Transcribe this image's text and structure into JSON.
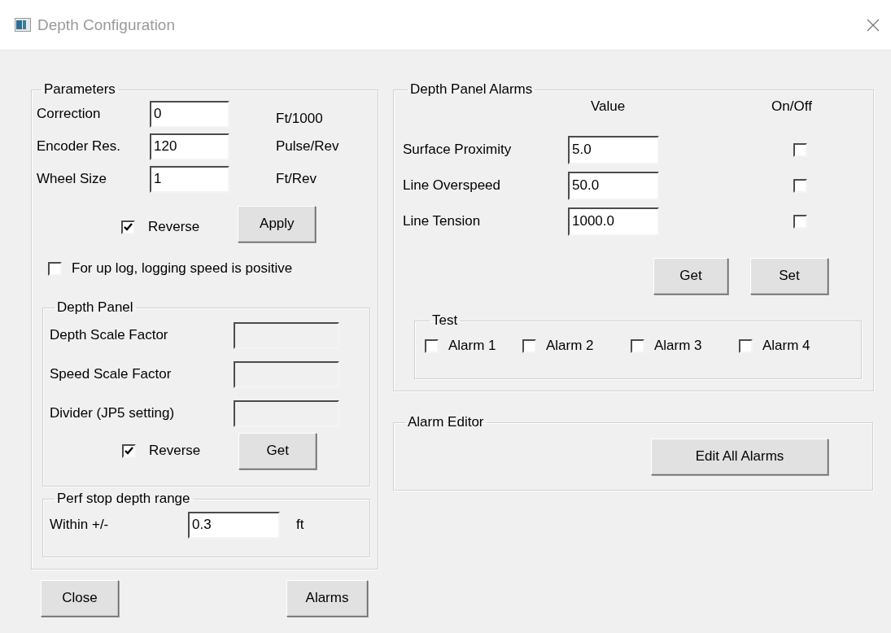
{
  "window": {
    "title": "Depth Configuration"
  },
  "parameters": {
    "title": "Parameters",
    "fields": [
      {
        "label": "Correction",
        "value": "0",
        "unit": "Ft/1000"
      },
      {
        "label": "Encoder Res.",
        "value": "120",
        "unit": "Pulse/Rev"
      },
      {
        "label": "Wheel Size",
        "value": "1",
        "unit": "Ft/Rev"
      }
    ],
    "reverse": {
      "label": "Reverse",
      "checked": true
    },
    "apply_button": "Apply",
    "up_log": {
      "label": "For up log, logging speed is positive",
      "checked": false
    },
    "depth_panel": {
      "title": "Depth Panel",
      "fields": [
        {
          "label": "Depth Scale Factor",
          "disabled": true
        },
        {
          "label": "Speed Scale Factor",
          "disabled": true
        },
        {
          "label": "Divider (JP5 setting)",
          "disabled": true
        }
      ],
      "reverse": {
        "label": "Reverse",
        "checked": true
      },
      "get_button": "Get"
    },
    "perf_stop": {
      "title": "Perf stop depth range",
      "label": "Within +/-",
      "value": "0.3",
      "unit": "ft"
    }
  },
  "alarms_panel": {
    "title": "Depth Panel Alarms",
    "columns": [
      "Value",
      "On/Off"
    ],
    "rows": [
      {
        "label": "Surface Proximity",
        "value": "5.0",
        "on": false
      },
      {
        "label": "Line Overspeed",
        "value": "50.0",
        "on": false
      },
      {
        "label": "Line Tension",
        "value": "1000.0",
        "on": false
      }
    ],
    "buttons": [
      "Get",
      "Set"
    ],
    "test": {
      "title": "Test",
      "items": [
        {
          "label": "Alarm 1",
          "checked": false
        },
        {
          "label": "Alarm 2",
          "checked": false
        },
        {
          "label": "Alarm 3",
          "checked": false
        },
        {
          "label": "Alarm 4",
          "checked": false
        }
      ]
    }
  },
  "alarm_editor": {
    "title": "Alarm Editor",
    "button": "Edit All Alarms"
  },
  "footer_buttons": [
    "Close",
    "Alarms"
  ]
}
